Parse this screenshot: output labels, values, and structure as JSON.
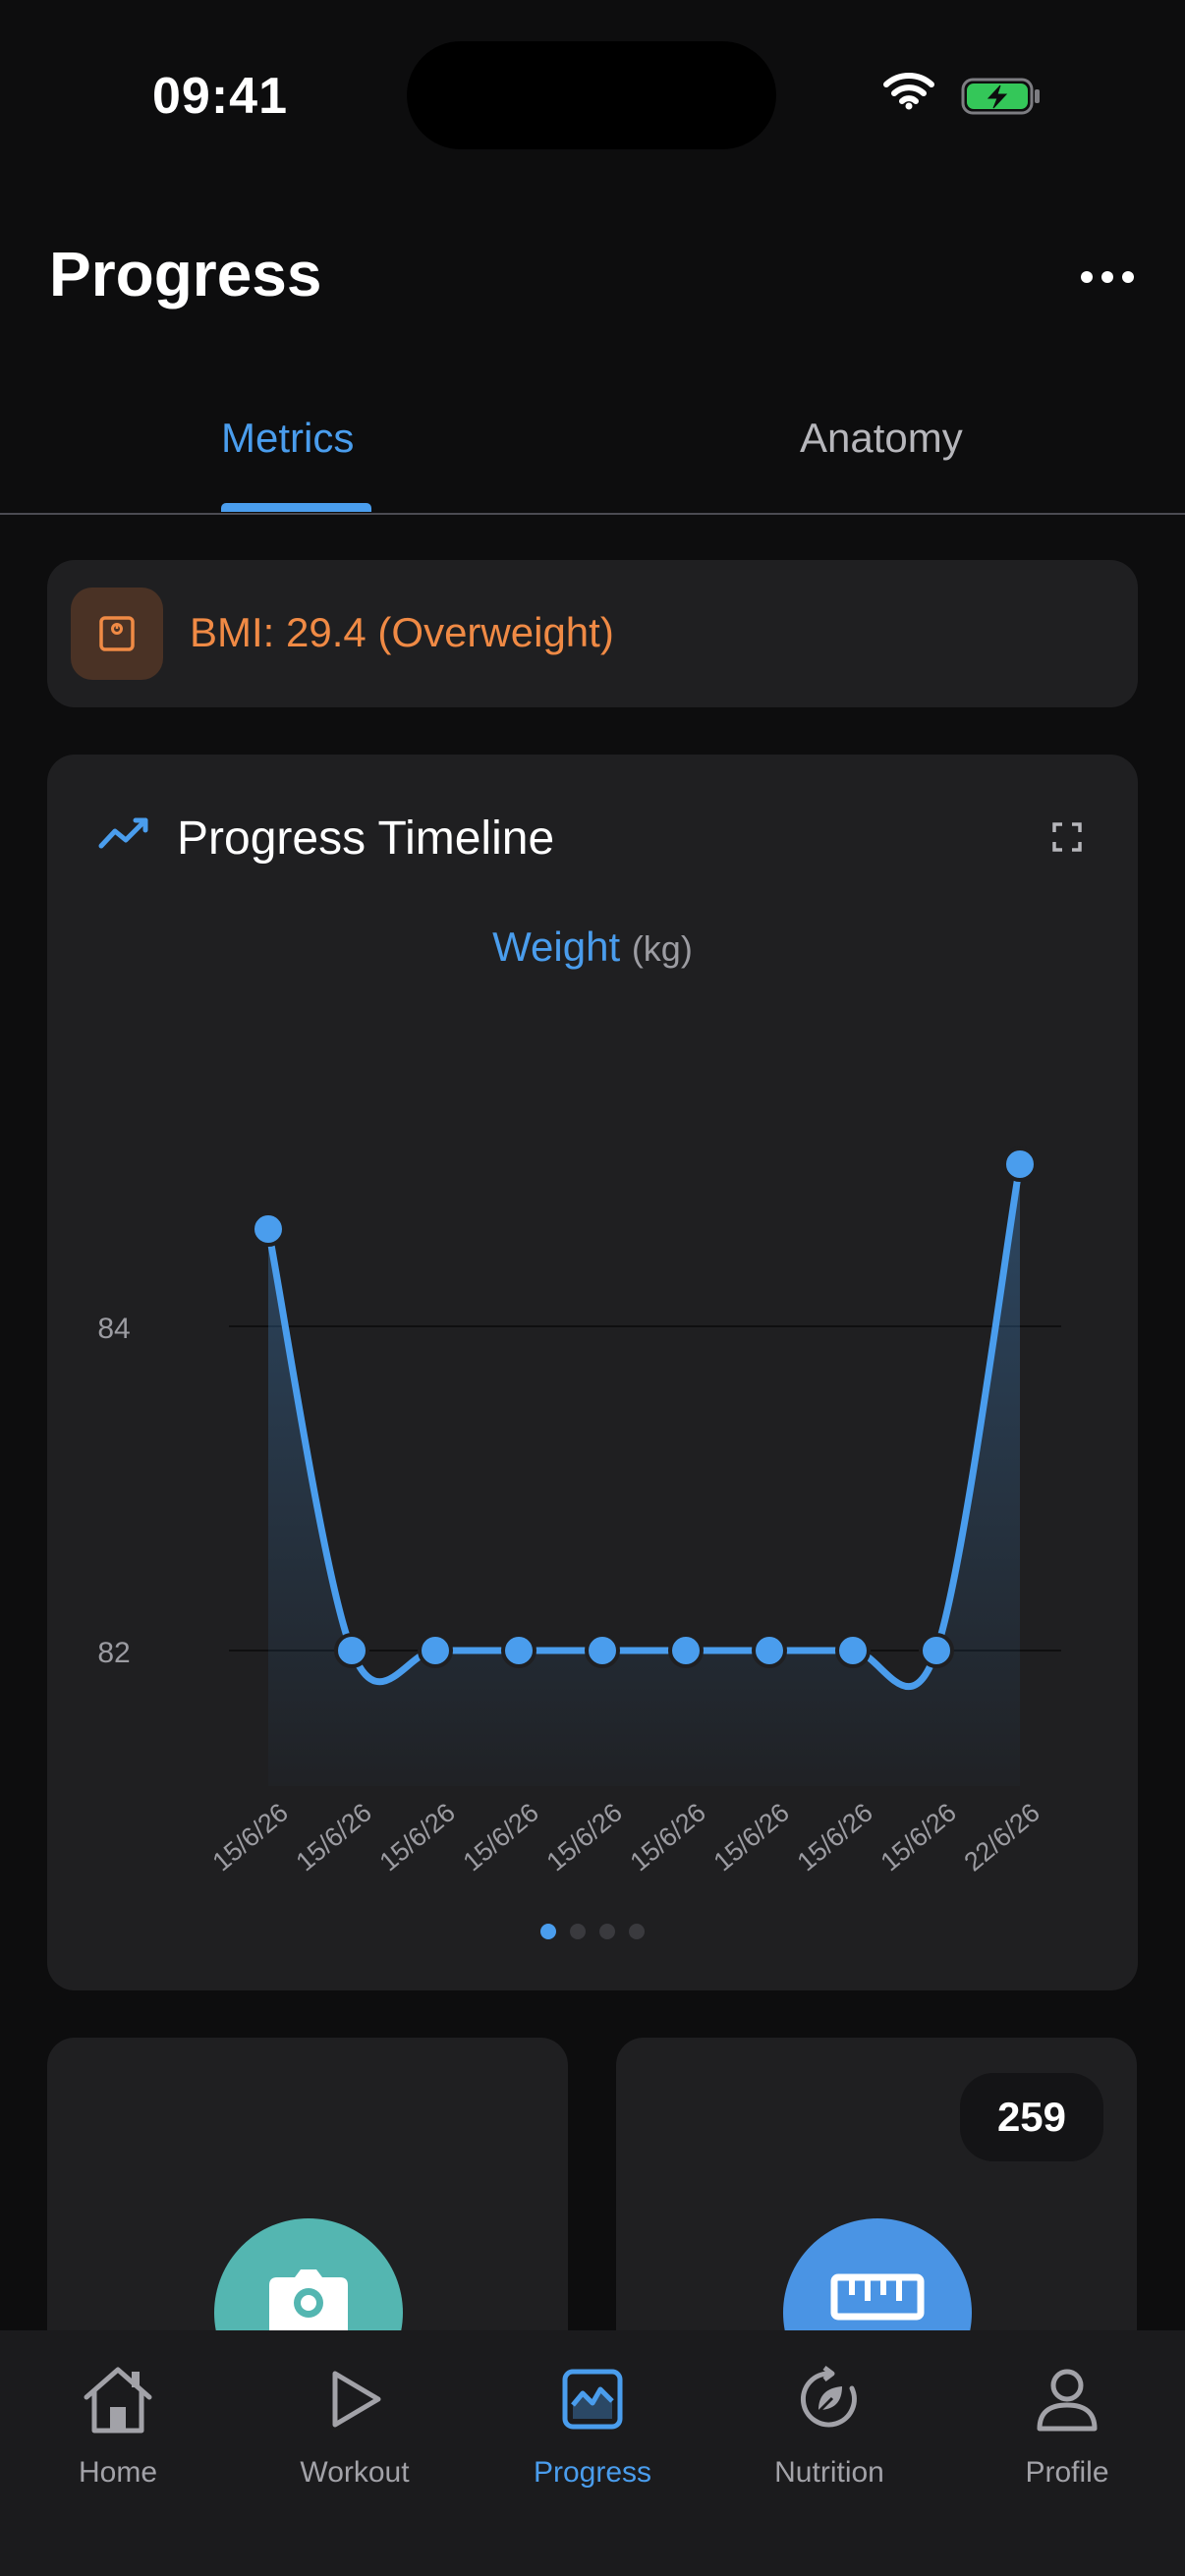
{
  "status_bar": {
    "time": "09:41"
  },
  "header": {
    "title": "Progress"
  },
  "tabs": [
    {
      "label": "Metrics",
      "active": true
    },
    {
      "label": "Anatomy",
      "active": false
    }
  ],
  "bmi": {
    "text": "BMI: 29.4 (Overweight)",
    "color": "#f08a45"
  },
  "timeline": {
    "title": "Progress Timeline",
    "metric_name": "Weight",
    "metric_unit": "(kg)",
    "page_count": 4,
    "active_page": 0
  },
  "chart_data": {
    "type": "line",
    "x": [
      "15/6/26",
      "15/6/26",
      "15/6/26",
      "15/6/26",
      "15/6/26",
      "15/6/26",
      "15/6/26",
      "15/6/26",
      "15/6/26",
      "22/6/26"
    ],
    "series": [
      {
        "values": [
          84.6,
          82,
          82,
          82,
          82,
          82,
          82,
          82,
          82,
          85
        ],
        "color": "#4a9ded"
      }
    ],
    "y_ticks": [
      82,
      84
    ],
    "ylim": [
      81,
      86.4
    ],
    "grid": true,
    "area_fill": true
  },
  "cards": {
    "measurement_count": "259"
  },
  "nav": [
    {
      "label": "Home",
      "icon": "home-icon",
      "active": false
    },
    {
      "label": "Workout",
      "icon": "play-icon",
      "active": false
    },
    {
      "label": "Progress",
      "icon": "chart-icon",
      "active": true
    },
    {
      "label": "Nutrition",
      "icon": "nutrition-icon",
      "active": false
    },
    {
      "label": "Profile",
      "icon": "person-icon",
      "active": false
    }
  ],
  "colors": {
    "accent": "#4a9ded",
    "background": "#0d0d0e",
    "card": "#1f1f21"
  }
}
